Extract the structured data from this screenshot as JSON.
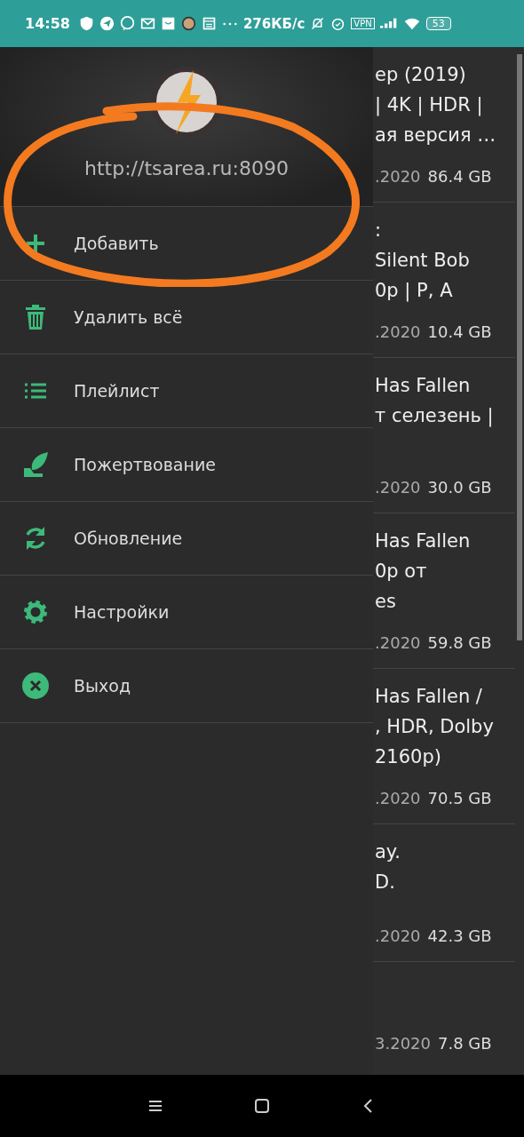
{
  "status_bar": {
    "time": "14:58",
    "speed": "276КБ/с",
    "vpn": "VPN",
    "battery": "53"
  },
  "drawer": {
    "server_url": "http://tsarea.ru:8090",
    "items": [
      {
        "kind": "add",
        "label": "Добавить"
      },
      {
        "kind": "delete",
        "label": "Удалить всё"
      },
      {
        "kind": "playlist",
        "label": "Плейлист"
      },
      {
        "kind": "donate",
        "label": "Пожертвование"
      },
      {
        "kind": "update",
        "label": "Обновление"
      },
      {
        "kind": "settings",
        "label": "Настройки"
      },
      {
        "kind": "exit",
        "label": "Выход"
      }
    ]
  },
  "annotation": {
    "kind": "scribble",
    "color": "#f47a20"
  },
  "torrents": [
    {
      "title_lines": [
        "ер (2019)",
        "| 4K | HDR |",
        "ая версия …"
      ],
      "date": ".2020",
      "size": "86.4 GB"
    },
    {
      "title_lines": [
        ":",
        "Silent Bob",
        "0p | P, A"
      ],
      "date": ".2020",
      "size": "10.4 GB"
    },
    {
      "title_lines": [
        "Has Fallen",
        "т селезень |"
      ],
      "date": ".2020",
      "size": "30.0 GB"
    },
    {
      "title_lines": [
        "Has Fallen",
        "0p от",
        "es"
      ],
      "date": ".2020",
      "size": "59.8 GB"
    },
    {
      "title_lines": [
        "Has Fallen /",
        ", HDR, Dolby",
        "2160p)"
      ],
      "date": ".2020",
      "size": "70.5 GB"
    },
    {
      "title_lines": [
        "ay.",
        "D."
      ],
      "date": ".2020",
      "size": "42.3 GB"
    },
    {
      "date": "3.2020",
      "size": "7.8 GB"
    }
  ]
}
